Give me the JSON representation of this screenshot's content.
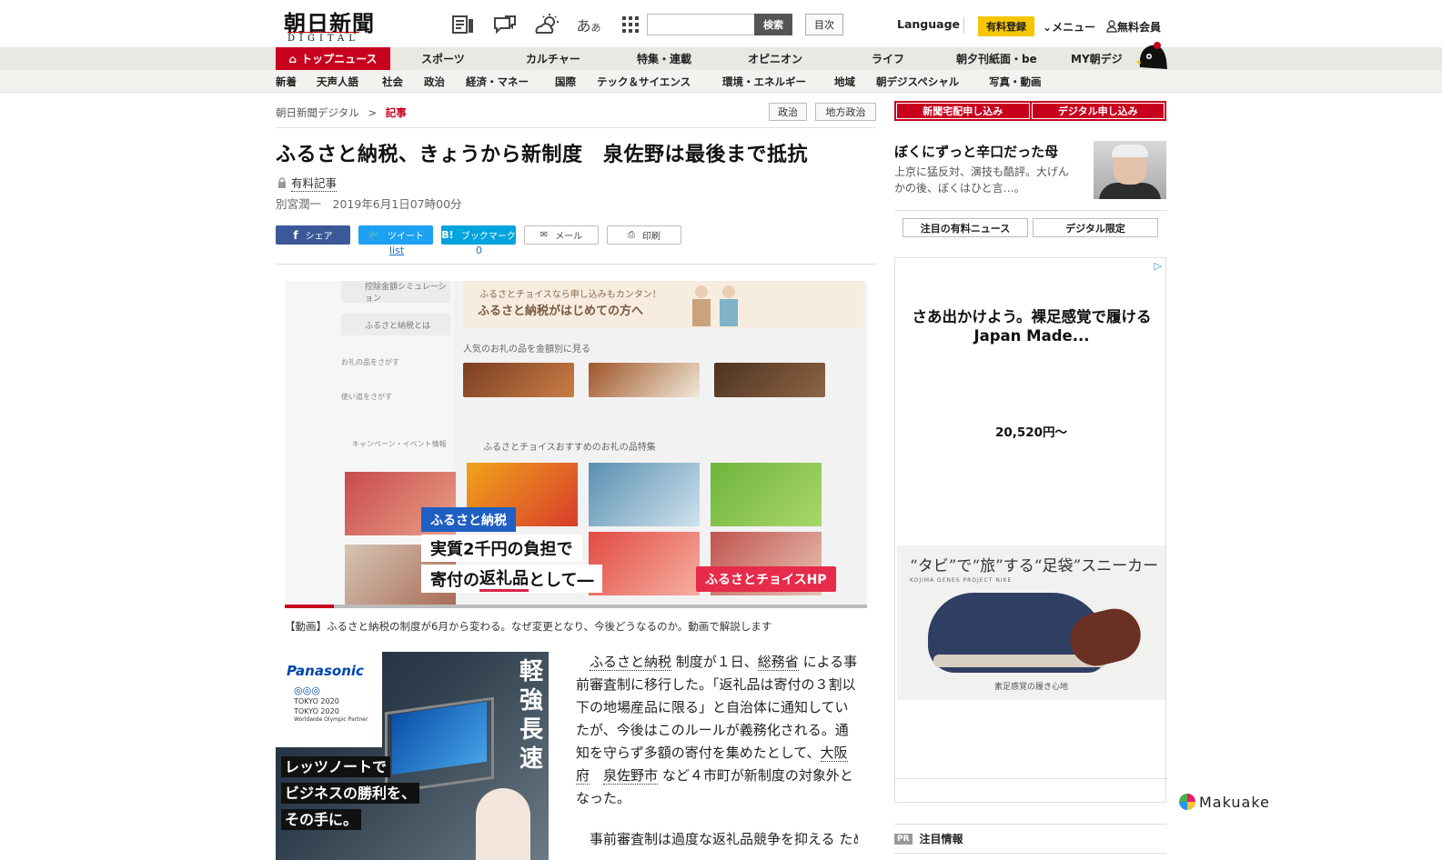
{
  "header": {
    "logo_text": "朝日新聞",
    "logo_sub": "DIGITAL",
    "search_button": "検索",
    "mokuji": "目次",
    "language": "Language",
    "yuryo": "有料登録",
    "menu": "メニュー",
    "member": "無料会員",
    "icons": [
      "paper-icon",
      "chat-icon",
      "weather-icon",
      "font-size-icon",
      "grid-icon"
    ]
  },
  "nav1": [
    "トップニュース",
    "スポーツ",
    "カルチャー",
    "特集・連載",
    "オピニオン",
    "ライフ",
    "朝夕刊紙面・be",
    "MY朝デジ"
  ],
  "nav2": [
    "新着",
    "天声人語",
    "社会",
    "政治",
    "経済・マネー",
    "国際",
    "テック＆サイエンス",
    "環境・エネルギー",
    "地域",
    "朝デジスペシャル",
    "写真・動画"
  ],
  "breadcrumb": {
    "home": "朝日新聞デジタル",
    "sep": ">",
    "current": "記事"
  },
  "tags": [
    "政治",
    "地方政治"
  ],
  "article": {
    "title": "ふるさと納税、きょうから新制度　泉佐野は最後まで抵抗",
    "paid_label": "有料記事",
    "byline": "別宮潤一　2019年6月1日07時00分",
    "share": {
      "facebook": "シェア",
      "twitter": "ツイート",
      "hatena": "ブックマーク",
      "mail": "メール",
      "print": "印刷",
      "twitter_count": "list",
      "hatena_count": "0"
    },
    "video": {
      "banner_small": "ふるさとチョイスなら申し込みもカンタン！",
      "banner_big": "ふるさと納税がはじめての方へ",
      "section1": "人気のお礼の品を金額別に見る",
      "section2": "ふるさとチョイスおすすめのお礼の品特集",
      "side1": "控除金額シミュレーション",
      "side2": "ふるさと納税とは",
      "side3": "お礼の品をさがす",
      "side4": "使い道をさがす",
      "side5": "キャンペーン・イベント情報",
      "cap_tag": "ふるさと納税",
      "cap_line1": "実質2千円の負担で",
      "cap_line2_pre": "寄付の",
      "cap_line2_u": "返礼品",
      "cap_line2_post": "として―",
      "cap_hp": "ふるさとチョイスHP",
      "caption": "【動画】ふるさと納税の制度が6月から変わる。なぜ変更となり、今後どうなるのか。動画で解説します",
      "progress": 0.085
    },
    "body_p1_parts": [
      "ふるさと納税",
      " 制度が１日、",
      "総務省",
      " による事前審査制に移行した。「返礼品は寄付の３割以下の地場産品に限る」と自治体に通知していたが、今後はこのルールが義務化される。通知を守らず多額の寄付を集めたとして、",
      "大阪府",
      "泉佐野市",
      " など４市町が新制度の対象外となった。"
    ],
    "body_p2": "事前審査制は過度な返礼品競争を抑える ため、改正 地方税法 により導入された"
  },
  "ad_left": {
    "brand": "Panasonic",
    "games1": "TOKYO 2020",
    "games2": "TOKYO 2020",
    "partner": "Worldwide Olympic Partner",
    "copy1": "レッツノートで",
    "copy2": "ビジネスの勝利を、",
    "copy3": "その手に。",
    "vertical": "軽強長速"
  },
  "right": {
    "btn1": "新聞宅配申し込み",
    "btn2": "デジタル申し込み",
    "feature_title": "ぼくにずっと辛口だった母",
    "feature_desc": "上京に猛反対、演技も酷評。大げんかの後、ぼくはひと言…。",
    "tab1": "注目の有料ニュース",
    "tab2": "デジタル限定",
    "ad": {
      "headline": "さあ出かけよう。裸足感覚で履ける Japan Made...",
      "price": "20,520円〜",
      "product_title": "“タビ”で“旅”する“足袋”スニーカー",
      "product_sub": "KOJIMA GENES PROJECT NIKE",
      "product_caption": "素足感覚の履き心地",
      "maker": "Makuake"
    },
    "pr_badge": "PR",
    "pr_label": "注目情報"
  }
}
